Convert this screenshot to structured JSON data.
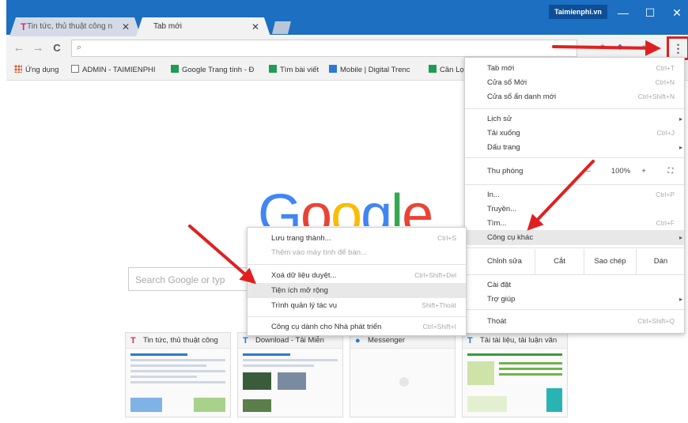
{
  "window": {
    "brand": "Taimienphi.vn",
    "minimize_glyph": "—",
    "maximize_glyph": "☐",
    "close_glyph": "✕"
  },
  "tabs": [
    {
      "label": "Tin tức, thủ thuật công n",
      "favicon": "T",
      "close": "✕"
    },
    {
      "label": "Tab mới",
      "close": "✕"
    }
  ],
  "toolbar": {
    "back_glyph": "←",
    "forward_glyph": "→",
    "reload_glyph": "C",
    "search_glyph": "⌕",
    "menu_glyph": "⋮"
  },
  "bookmarks": [
    {
      "label": "Ứng dụng",
      "icon": "apps-icon",
      "color": "#e05b2a"
    },
    {
      "label": "ADMIN - TAIMIENPHI",
      "icon": "page-icon",
      "color": "#777777"
    },
    {
      "label": "Google Trang tính - Đ",
      "icon": "sheets-icon",
      "color": "#1e9c57"
    },
    {
      "label": "Tìm bài viết",
      "icon": "sheets-icon",
      "color": "#1e9c57"
    },
    {
      "label": "Mobile | Digital Trenc",
      "icon": "digital-icon",
      "color": "#2a7ad5"
    },
    {
      "label": "Cần Lọ",
      "icon": "sheets-icon",
      "color": "#1e9c57"
    }
  ],
  "main": {
    "logo": [
      "G",
      "o",
      "o",
      "g",
      "l",
      "e"
    ],
    "search_placeholder": "Search Google or typ",
    "thumbnails": [
      {
        "title": "Tin tức, thủ thuật công",
        "icon": "T",
        "icon_color": "#d32f6b"
      },
      {
        "title": "Download - Tải Miễn",
        "icon": "T",
        "icon_color": "#2a7ad5"
      },
      {
        "title": "Messenger",
        "icon": "●",
        "icon_color": "#2a7ad5"
      },
      {
        "title": "Tải tài liệu, tải luận văn",
        "icon": "T",
        "icon_color": "#2a7ad5"
      }
    ]
  },
  "chrome_menu": {
    "group1": [
      {
        "label": "Tab mới",
        "shortcut": "Ctrl+T"
      },
      {
        "label": "Cửa sổ Mới",
        "shortcut": "Ctrl+N"
      },
      {
        "label": "Cửa sổ ẩn danh mới",
        "shortcut": "Ctrl+Shift+N"
      }
    ],
    "group2": [
      {
        "label": "Lịch sử",
        "arrow": "▸"
      },
      {
        "label": "Tải xuống",
        "shortcut": "Ctrl+J"
      },
      {
        "label": "Dấu trang",
        "arrow": "▸"
      }
    ],
    "zoom": {
      "label": "Thu phóng",
      "minus": "–",
      "value": "100%",
      "plus": "+",
      "fullscreen": "⛶"
    },
    "group3": [
      {
        "label": "In...",
        "shortcut": "Ctrl+P"
      },
      {
        "label": "Truyền...",
        "shortcut": ""
      },
      {
        "label": "Tìm...",
        "shortcut": "Ctrl+F"
      },
      {
        "label": "Công cụ khác",
        "arrow": "▸"
      }
    ],
    "edit": {
      "label": "Chỉnh sửa",
      "cut": "Cắt",
      "copy": "Sao chép",
      "paste": "Dán"
    },
    "group4": [
      {
        "label": "Cài đặt",
        "shortcut": ""
      },
      {
        "label": "Trợ giúp",
        "arrow": "▸"
      }
    ],
    "exit": {
      "label": "Thoát",
      "shortcut": "Ctrl+Shift+Q"
    }
  },
  "submenu": {
    "items": [
      {
        "label": "Lưu trang thành...",
        "shortcut": "Ctrl+S"
      },
      {
        "label": "Thêm vào máy tính để bàn...",
        "shortcut": ""
      },
      {
        "label": "Xoá dữ liệu duyệt...",
        "shortcut": "Ctrl+Shift+Del"
      },
      {
        "label": "Tiện ích mở rộng",
        "shortcut": ""
      },
      {
        "label": "Trình quản lý tác vụ",
        "shortcut": "Shift+Thoát"
      },
      {
        "label": "Công cụ dành cho Nhà phát triển",
        "shortcut": "Ctrl+Shift+I"
      }
    ]
  },
  "colors": {
    "accent": "#1c6fc1",
    "annotation": "#e02020"
  }
}
